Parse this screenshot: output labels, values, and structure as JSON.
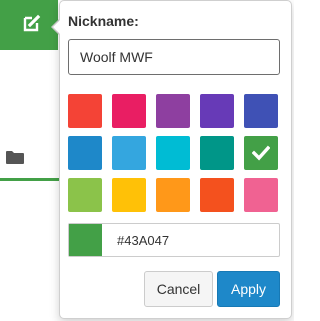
{
  "nickname": {
    "label": "Nickname:",
    "value": "Woolf MWF"
  },
  "colors": {
    "accent": "#43A047",
    "swatches": [
      {
        "hex": "#F44336",
        "selected": false
      },
      {
        "hex": "#E91E63",
        "selected": false
      },
      {
        "hex": "#8E3FA0",
        "selected": false
      },
      {
        "hex": "#673AB7",
        "selected": false
      },
      {
        "hex": "#3F51B5",
        "selected": false
      },
      {
        "hex": "#1E88C9",
        "selected": false
      },
      {
        "hex": "#34A6DF",
        "selected": false
      },
      {
        "hex": "#00BCD4",
        "selected": false
      },
      {
        "hex": "#009688",
        "selected": false
      },
      {
        "hex": "#43A047",
        "selected": true
      },
      {
        "hex": "#8BC34A",
        "selected": false
      },
      {
        "hex": "#FFC107",
        "selected": false
      },
      {
        "hex": "#FF9819",
        "selected": false
      },
      {
        "hex": "#F4511E",
        "selected": false
      },
      {
        "hex": "#F06292",
        "selected": false
      }
    ]
  },
  "hex_field": {
    "value": "#43A047"
  },
  "buttons": {
    "cancel": "Cancel",
    "apply": "Apply"
  },
  "icons": {
    "edit": "edit-icon",
    "folder": "folder-icon",
    "check": "check-icon"
  }
}
